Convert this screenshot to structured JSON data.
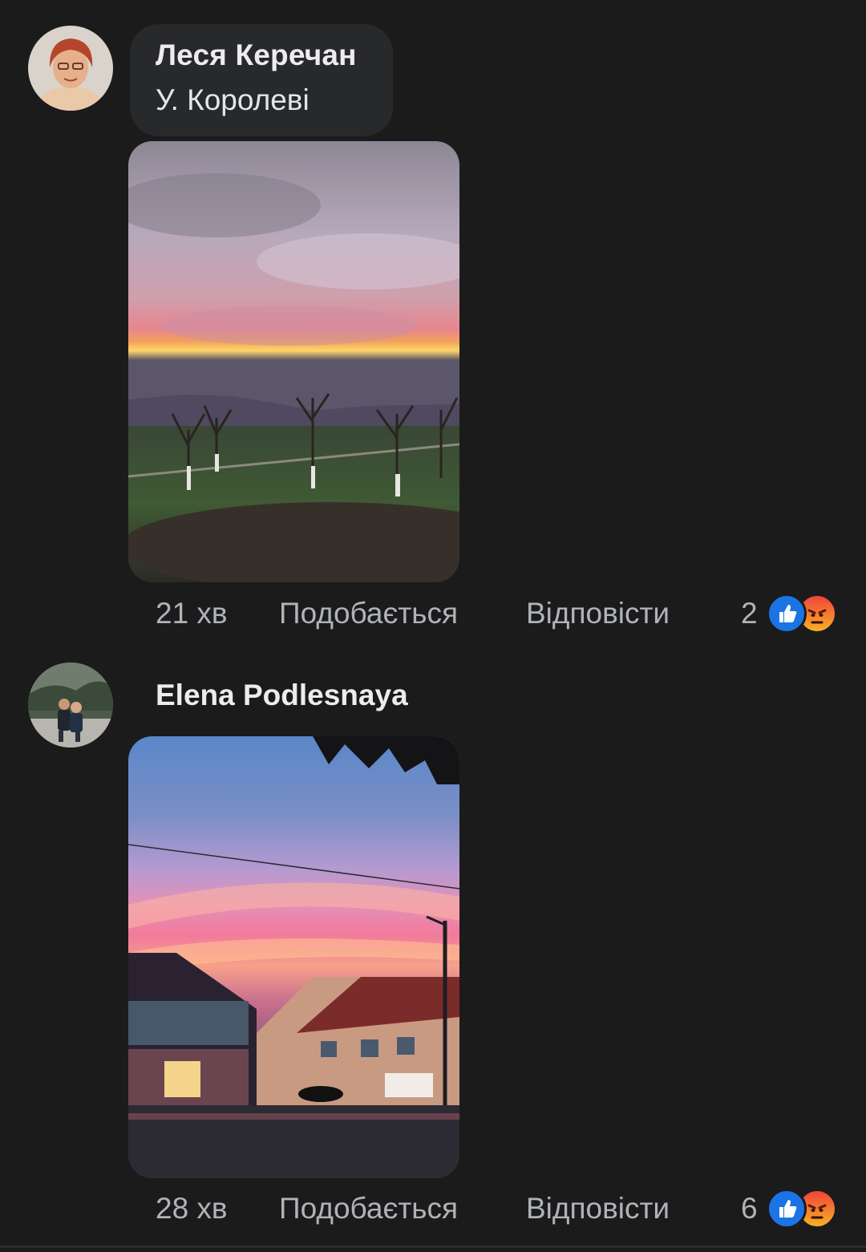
{
  "comments": [
    {
      "author": "Леся Керечан",
      "text": "У. Королеві",
      "time": "21 хв",
      "like_label": "Подобається",
      "reply_label": "Відповісти",
      "reaction_count": "2",
      "reactions": [
        "like-icon",
        "angry-icon"
      ],
      "photo": "sunset-orchard-photo"
    },
    {
      "author": "Elena Podlesnaya",
      "text": "",
      "time": "28 хв",
      "like_label": "Подобається",
      "reply_label": "Відповісти",
      "reaction_count": "6",
      "reactions": [
        "like-icon",
        "angry-icon"
      ],
      "photo": "sunset-street-photo"
    }
  ],
  "colors": {
    "background": "#1b1b1c",
    "bubble": "#28292b",
    "meta_text": "#b0b3b8",
    "like_blue": "#1b74e4",
    "angry_orange": "#f0433a"
  }
}
